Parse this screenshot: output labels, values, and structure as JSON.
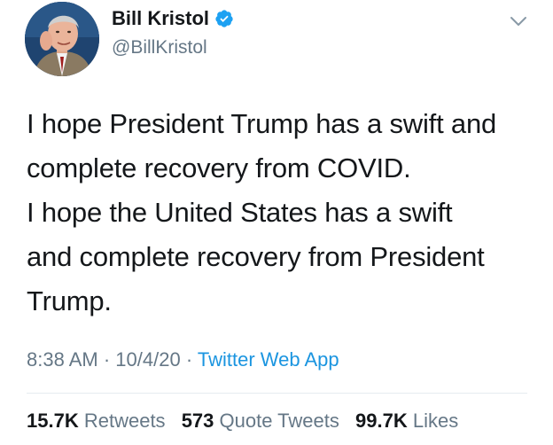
{
  "author": {
    "display_name": "Bill Kristol",
    "handle": "@BillKristol",
    "verified_icon": "verified-badge-icon",
    "avatar_icon": "profile-photo"
  },
  "menu": {
    "icon": "chevron-down-icon"
  },
  "tweet": {
    "lines": [
      "I hope President Trump has a swift and",
      "complete recovery from COVID.",
      "I hope the United States has a swift",
      "and complete recovery from President",
      "Trump."
    ]
  },
  "meta": {
    "time": "8:38 AM",
    "separator": "·",
    "date": "10/4/20",
    "source": "Twitter Web App"
  },
  "stats": {
    "retweets_count": "15.7K",
    "retweets_label": "Retweets",
    "quotes_count": "573",
    "quotes_label": "Quote Tweets",
    "likes_count": "99.7K",
    "likes_label": "Likes"
  },
  "colors": {
    "text": "#14171a",
    "secondary": "#657786",
    "link": "#1b95e0",
    "verified": "#1da1f2",
    "divider": "#e6ecf0"
  }
}
